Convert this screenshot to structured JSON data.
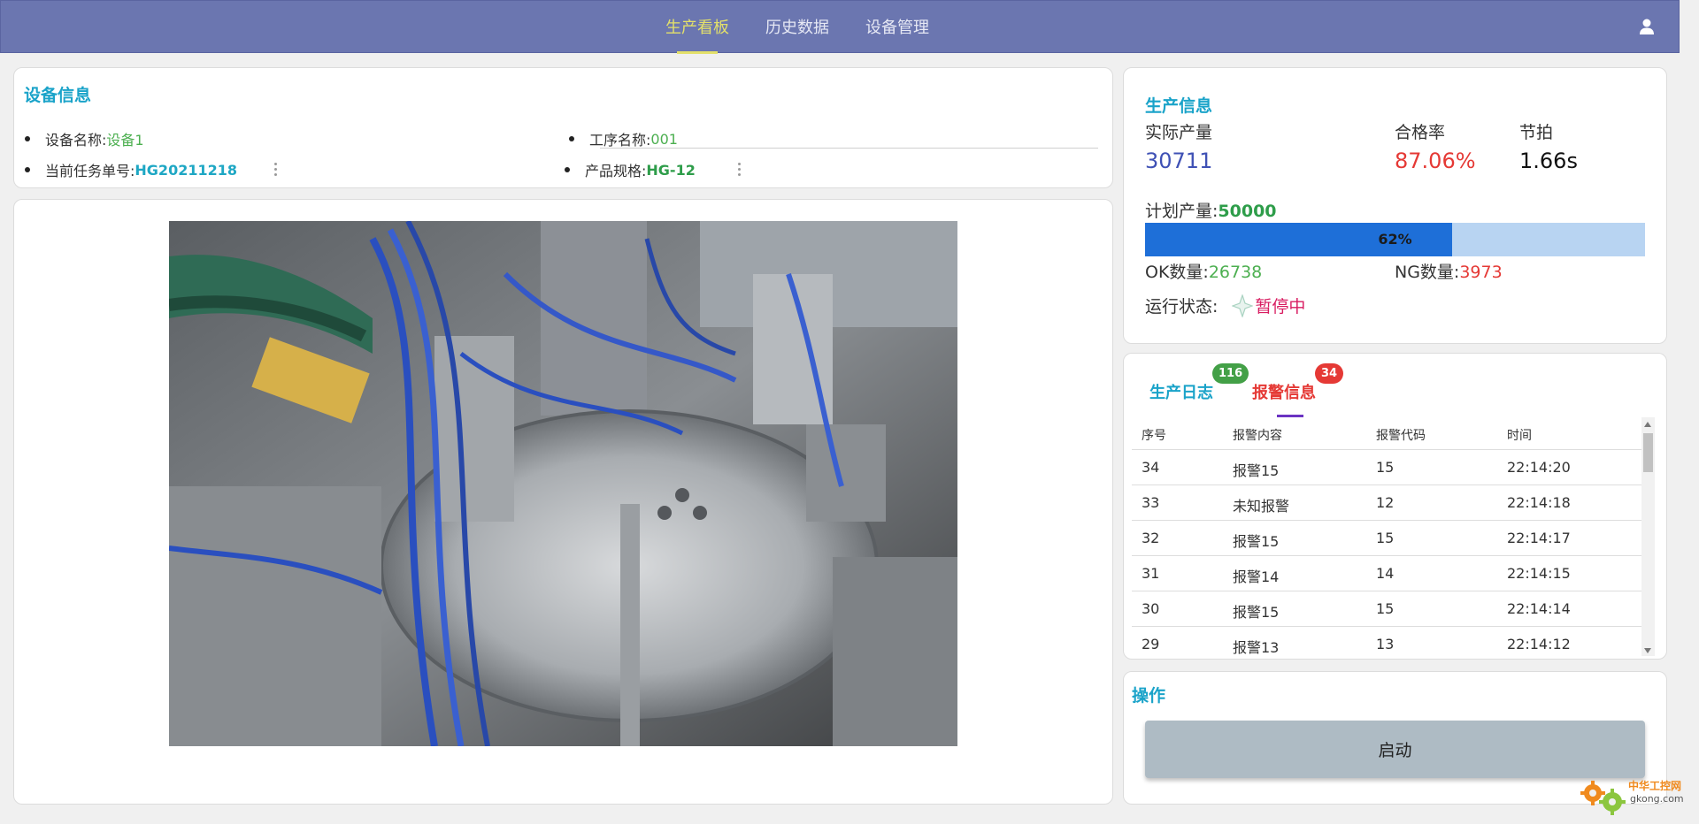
{
  "nav": {
    "items": [
      "生产看板",
      "历史数据",
      "设备管理"
    ],
    "active_index": 0
  },
  "device": {
    "title": "设备信息",
    "name_label": "设备名称:",
    "name_value": "设备1",
    "process_label": "工序名称:",
    "process_value": "001",
    "task_label": "当前任务单号:",
    "task_value": "HG20211218",
    "spec_label": "产品规格:",
    "spec_value": "HG-12"
  },
  "production": {
    "title": "生产信息",
    "actual_label": "实际产量",
    "actual_value": "30711",
    "pass_rate_label": "合格率",
    "pass_rate_value": "87.06%",
    "cycle_label": "节拍",
    "cycle_value": "1.66s",
    "plan_label": "计划产量:",
    "plan_value": "50000",
    "progress_text": "62%",
    "progress_fraction": 0.614,
    "ok_label": "OK数量:",
    "ok_value": "26738",
    "ng_label": "NG数量:",
    "ng_value": "3973",
    "status_label": "运行状态:",
    "status_value": "暂停中",
    "colors": {
      "actual": "#3f51b5",
      "pass_rate": "#e53935",
      "plan": "#2e9d4a",
      "ok": "#4caf50",
      "ng": "#e53935",
      "status": "#d81b60"
    }
  },
  "tabs": {
    "log_label": "生产日志",
    "log_badge": "116",
    "alarm_label": "报警信息",
    "alarm_badge": "34",
    "active": "alarm"
  },
  "alarm_table": {
    "headers": [
      "序号",
      "报警内容",
      "报警代码",
      "时间"
    ],
    "rows": [
      [
        "34",
        "报警15",
        "15",
        "22:14:20"
      ],
      [
        "33",
        "未知报警",
        "12",
        "22:14:18"
      ],
      [
        "32",
        "报警15",
        "15",
        "22:14:17"
      ],
      [
        "31",
        "报警14",
        "14",
        "22:14:15"
      ],
      [
        "30",
        "报警15",
        "15",
        "22:14:14"
      ],
      [
        "29",
        "报警13",
        "13",
        "22:14:12"
      ]
    ]
  },
  "operation": {
    "title": "操作",
    "start_label": "启动"
  },
  "watermark": {
    "line1": "中华工控网",
    "line2": "gkong.com"
  }
}
